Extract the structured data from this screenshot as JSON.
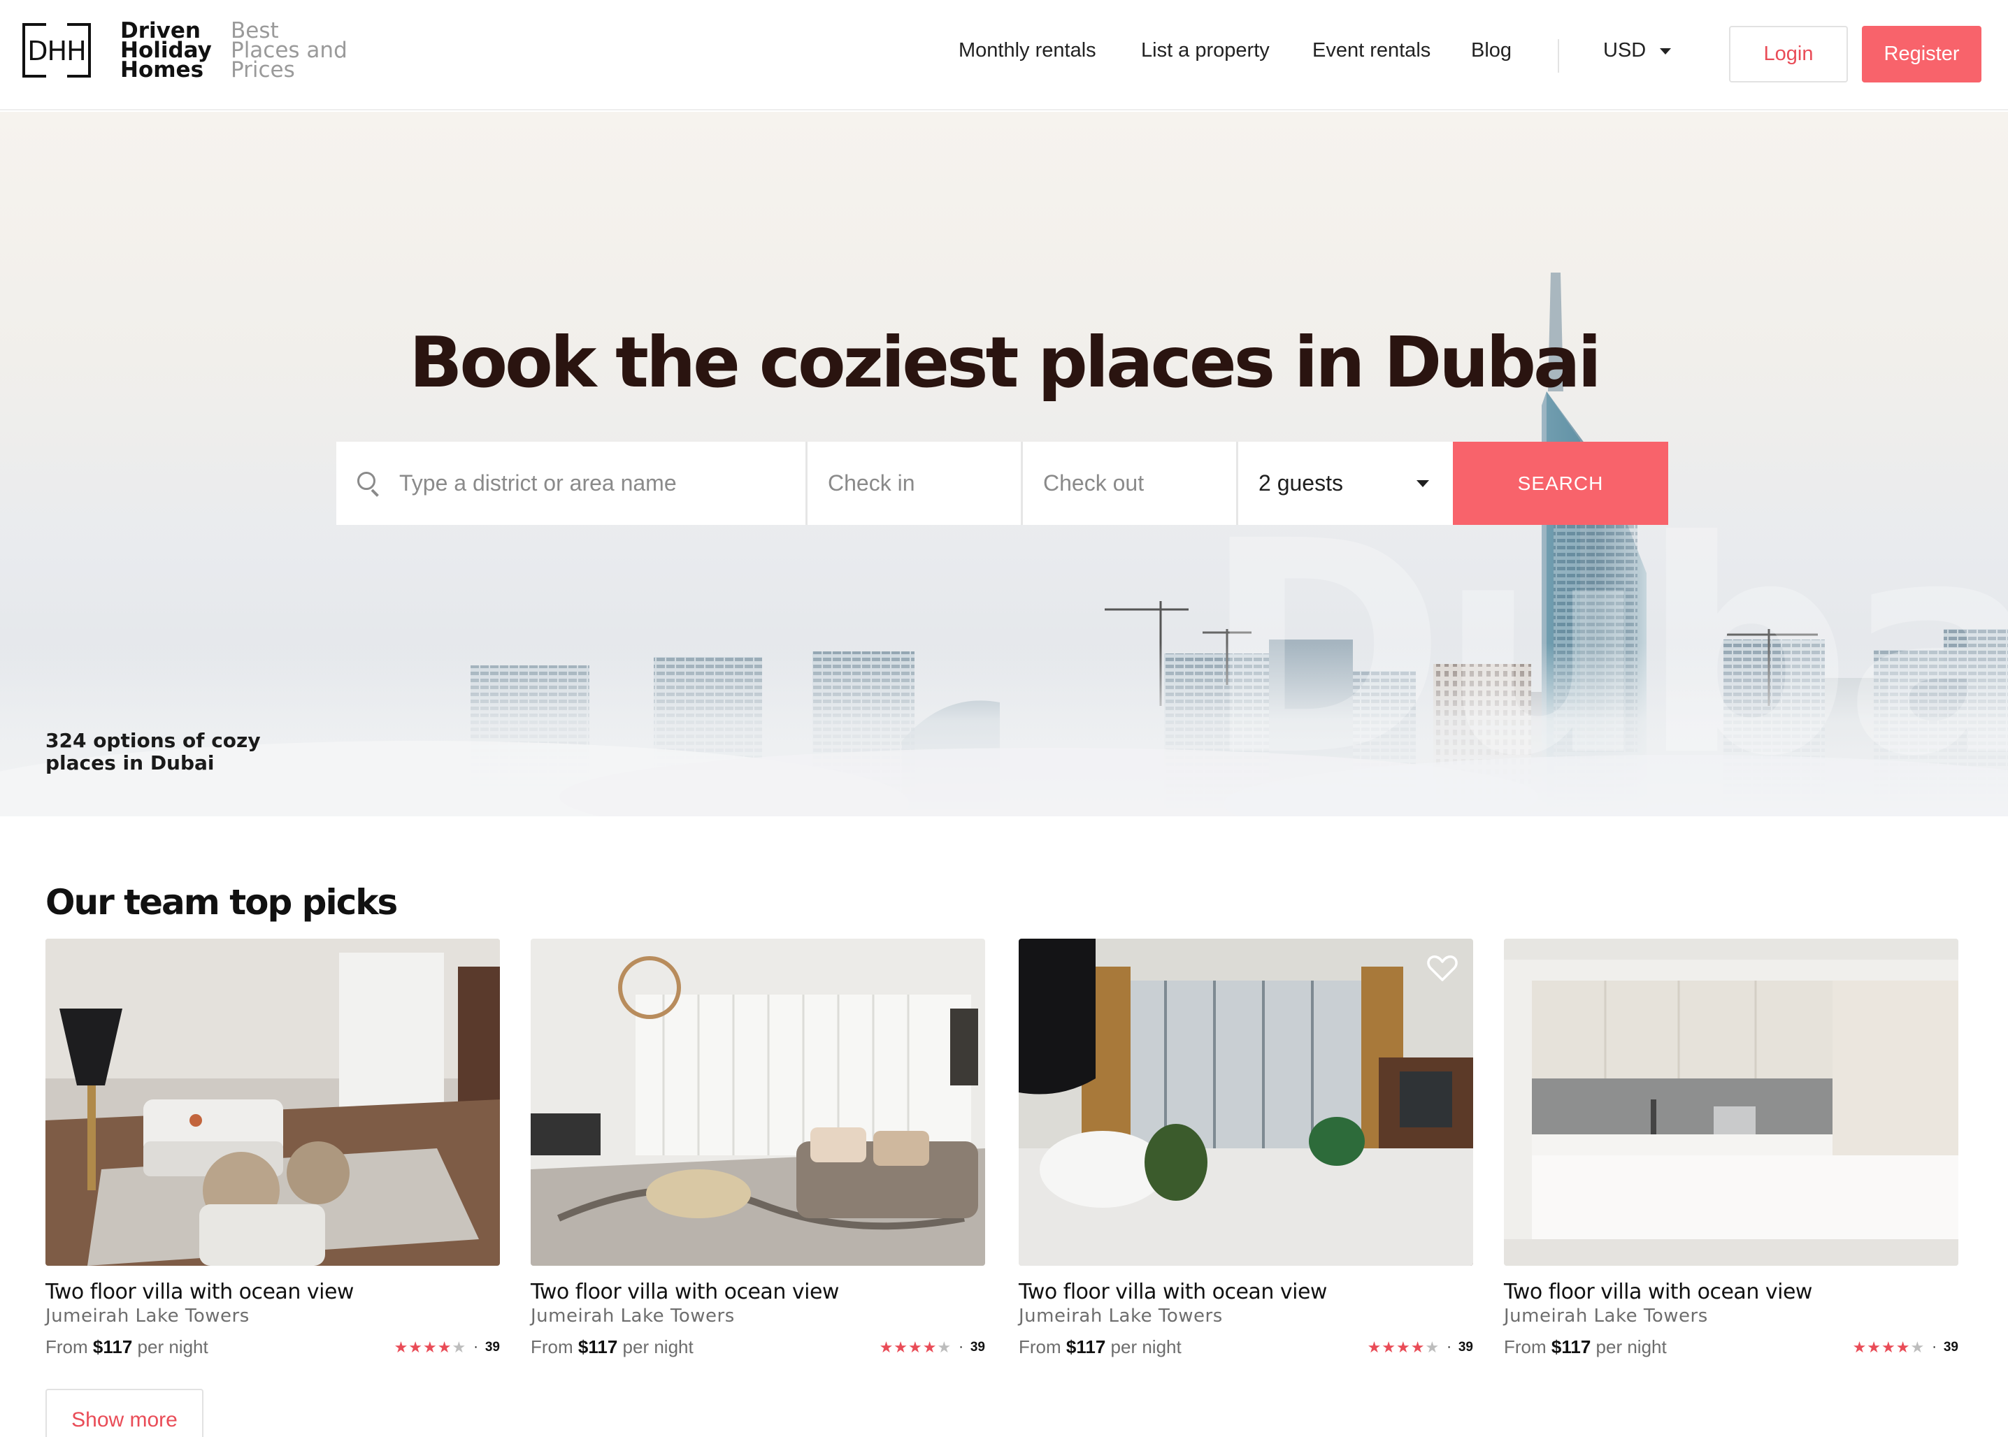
{
  "brand": {
    "mark": "DHH",
    "name_lines": [
      "Driven",
      "Holiday",
      "Homes"
    ],
    "tagline_lines": [
      "Best",
      "Places and",
      "Prices"
    ]
  },
  "nav": {
    "items": [
      "Monthly rentals",
      "List a property",
      "Event rentals",
      "Blog"
    ],
    "currency": "USD",
    "login": "Login",
    "register": "Register"
  },
  "hero": {
    "title": "Book the coziest places in Dubai",
    "count_text": "324 options of cozy places in Dubai",
    "watermark": "Dubai"
  },
  "search": {
    "location_placeholder": "Type a district or area name",
    "check_in": "Check in",
    "check_out": "Check out",
    "guests": "2 guests",
    "button": "SEARCH"
  },
  "picks": {
    "title": "Our team top picks",
    "cards": [
      {
        "title": "Two floor villa with ocean view",
        "location": "Jumeirah Lake Towers",
        "from": "From",
        "price": "$117",
        "per": "per night",
        "rating": 4,
        "reviews": "39"
      },
      {
        "title": "Two floor villa with ocean view",
        "location": "Jumeirah Lake Towers",
        "from": "From",
        "price": "$117",
        "per": "per night",
        "rating": 4,
        "reviews": "39"
      },
      {
        "title": "Two floor villa with ocean view",
        "location": "Jumeirah Lake Towers",
        "from": "From",
        "price": "$117",
        "per": "per night",
        "rating": 4,
        "reviews": "39"
      },
      {
        "title": "Two floor villa with ocean view",
        "location": "Jumeirah Lake Towers",
        "from": "From",
        "price": "$117",
        "per": "per night",
        "rating": 4,
        "reviews": "39"
      }
    ],
    "show_more": "Show more"
  },
  "colors": {
    "accent": "#f8636b",
    "accent_text": "#e94c57",
    "hero_title": "#2a1410"
  }
}
